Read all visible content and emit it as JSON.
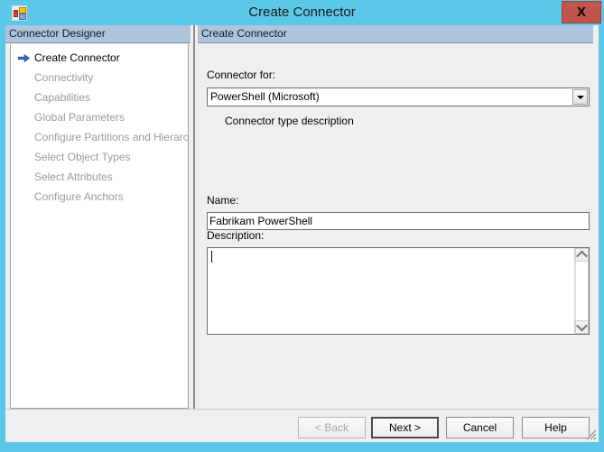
{
  "window": {
    "title": "Create Connector",
    "icon": "app-tiles-icon",
    "close_label": "X",
    "chrome_color": "#5BC8E8",
    "close_color": "#C0564B"
  },
  "sidebar": {
    "header": "Connector Designer",
    "items": [
      {
        "label": "Create Connector",
        "active": true
      },
      {
        "label": "Connectivity",
        "active": false
      },
      {
        "label": "Capabilities",
        "active": false
      },
      {
        "label": "Global Parameters",
        "active": false
      },
      {
        "label": "Configure Partitions and Hierarchies",
        "active": false
      },
      {
        "label": "Select Object Types",
        "active": false
      },
      {
        "label": "Select Attributes",
        "active": false
      },
      {
        "label": "Configure Anchors",
        "active": false
      }
    ]
  },
  "main": {
    "header": "Create Connector",
    "connector_for_label": "Connector for:",
    "connector_for_value": "PowerShell (Microsoft)",
    "connector_type_description": "Connector type description",
    "name_label": "Name:",
    "name_value": "Fabrikam PowerShell",
    "name_placeholder": "",
    "description_label": "Description:",
    "description_value": "",
    "description_placeholder": ""
  },
  "footer": {
    "back": "<  Back",
    "next": "Next  >",
    "cancel": "Cancel",
    "help": "Help"
  }
}
